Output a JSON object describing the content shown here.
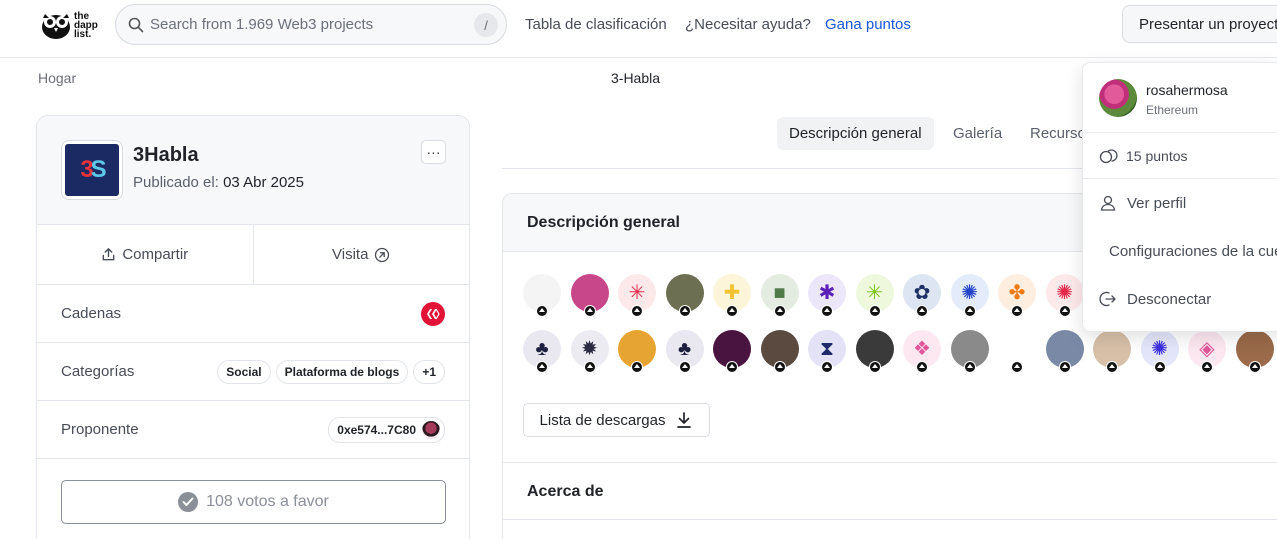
{
  "header": {
    "logo_lines": [
      "the",
      "dapp",
      "list."
    ],
    "search_placeholder": "Search from 1.969 Web3 projects",
    "search_shortcut": "/",
    "nav": {
      "leaderboard": "Tabla de clasificación",
      "help": "¿Necesitar ayuda?",
      "earn": "Gana puntos"
    },
    "submit_label": "Presentar un proyecto"
  },
  "breadcrumb": {
    "home": "Hogar",
    "current": "3-Habla"
  },
  "project": {
    "logo_text_a": "3",
    "logo_text_b": "S",
    "name": "3Habla",
    "published_label": "Publicado el:",
    "published_date": "03 Abr 2025",
    "more_label": "···",
    "share_label": "Compartir",
    "visit_label": "Visita",
    "chains_label": "Cadenas",
    "chain_color": "#e31337",
    "categories_label": "Categorías",
    "categories": [
      "Social",
      "Plataforma de blogs",
      "+1"
    ],
    "proposer_label": "Proponente",
    "proposer_address": "0xe574...7C80",
    "votes_label": "108 votos a favor"
  },
  "tabs": [
    "Descripción general",
    "Galería",
    "Recursos"
  ],
  "overview": {
    "title": "Descripción general",
    "download_label": "Lista de descargas",
    "about_title": "Acerca de",
    "avatar_rows": [
      [
        {
          "bg": "#f4f4f4",
          "glyph": "",
          "color": "#a02850",
          "icon": "creature-avatar"
        },
        {
          "bg": "#c8478a",
          "glyph": "",
          "color": "#fff",
          "icon": "roses-photo"
        },
        {
          "bg": "#fde8ea",
          "glyph": "✳",
          "color": "#e6294a",
          "icon": "asterisk-red"
        },
        {
          "bg": "#6d6f52",
          "glyph": "",
          "color": "#fff",
          "icon": "person-photo"
        },
        {
          "bg": "#fdf5d9",
          "glyph": "✚",
          "color": "#f2c230",
          "icon": "cross-yellow"
        },
        {
          "bg": "#e4ece2",
          "glyph": "■",
          "color": "#517a4a",
          "icon": "square-green"
        },
        {
          "bg": "#ece6fb",
          "glyph": "✱",
          "color": "#5b21b6",
          "icon": "star-purple"
        },
        {
          "bg": "#eef8dc",
          "glyph": "✳",
          "color": "#7cc618",
          "icon": "asterisk-lime"
        },
        {
          "bg": "#dde5f3",
          "glyph": "✿",
          "color": "#1e2f66",
          "icon": "flower-navy"
        },
        {
          "bg": "#e4ebfb",
          "glyph": "✺",
          "color": "#2343c8",
          "icon": "burst-blue"
        },
        {
          "bg": "#feeee0",
          "glyph": "✤",
          "color": "#f07a14",
          "icon": "clover-orange"
        },
        {
          "bg": "#fde8ea",
          "glyph": "✺",
          "color": "#e6294a",
          "icon": "burst-red"
        }
      ],
      [
        {
          "bg": "#e9e8f0",
          "glyph": "♣",
          "color": "#1f2040",
          "icon": "club-dark"
        },
        {
          "bg": "#ecebf1",
          "glyph": "✹",
          "color": "#2b2b42",
          "icon": "gear-dark"
        },
        {
          "bg": "#e6a532",
          "glyph": "",
          "color": "#333",
          "icon": "animal-photo"
        },
        {
          "bg": "#e9e8f0",
          "glyph": "♣",
          "color": "#1f2040",
          "icon": "club-dark"
        },
        {
          "bg": "#4a1440",
          "glyph": "",
          "color": "#fff",
          "icon": "figure-photo"
        },
        {
          "bg": "#5a4a40",
          "glyph": "",
          "color": "#fff",
          "icon": "person-photo"
        },
        {
          "bg": "#e4e2f7",
          "glyph": "⧗",
          "color": "#1e2a6a",
          "icon": "hourglass-navy"
        },
        {
          "bg": "#3a3a3a",
          "glyph": "",
          "color": "#fff",
          "icon": "person-photo"
        },
        {
          "bg": "#fde8f1",
          "glyph": "❖",
          "color": "#e0569a",
          "icon": "diamond-pink"
        },
        {
          "bg": "#8a8a8a",
          "glyph": "",
          "color": "#fff",
          "icon": "person-photo"
        },
        {
          "bg": "#ffffff",
          "glyph": "",
          "color": "#a020c0",
          "icon": "cartoon-face"
        },
        {
          "bg": "#7a8aa6",
          "glyph": "",
          "color": "#fff",
          "icon": "person-photo"
        },
        {
          "bg": "#d8c0a8",
          "glyph": "",
          "color": "#fff",
          "icon": "person-photo"
        },
        {
          "bg": "#e4e6fb",
          "glyph": "✺",
          "color": "#3b2fe0",
          "icon": "burst-indigo"
        },
        {
          "bg": "#fde8f1",
          "glyph": "◈",
          "color": "#e0569a",
          "icon": "diamond-outline-pink"
        },
        {
          "bg": "#9a6a4a",
          "glyph": "",
          "color": "#fff",
          "icon": "person-photo"
        }
      ]
    ]
  },
  "user_menu": {
    "username": "rosahermosa",
    "chain": "Ethereum",
    "points": "15 puntos",
    "view_profile": "Ver perfil",
    "settings": "Configuraciones de la cuenta",
    "logout": "Desconectar"
  }
}
